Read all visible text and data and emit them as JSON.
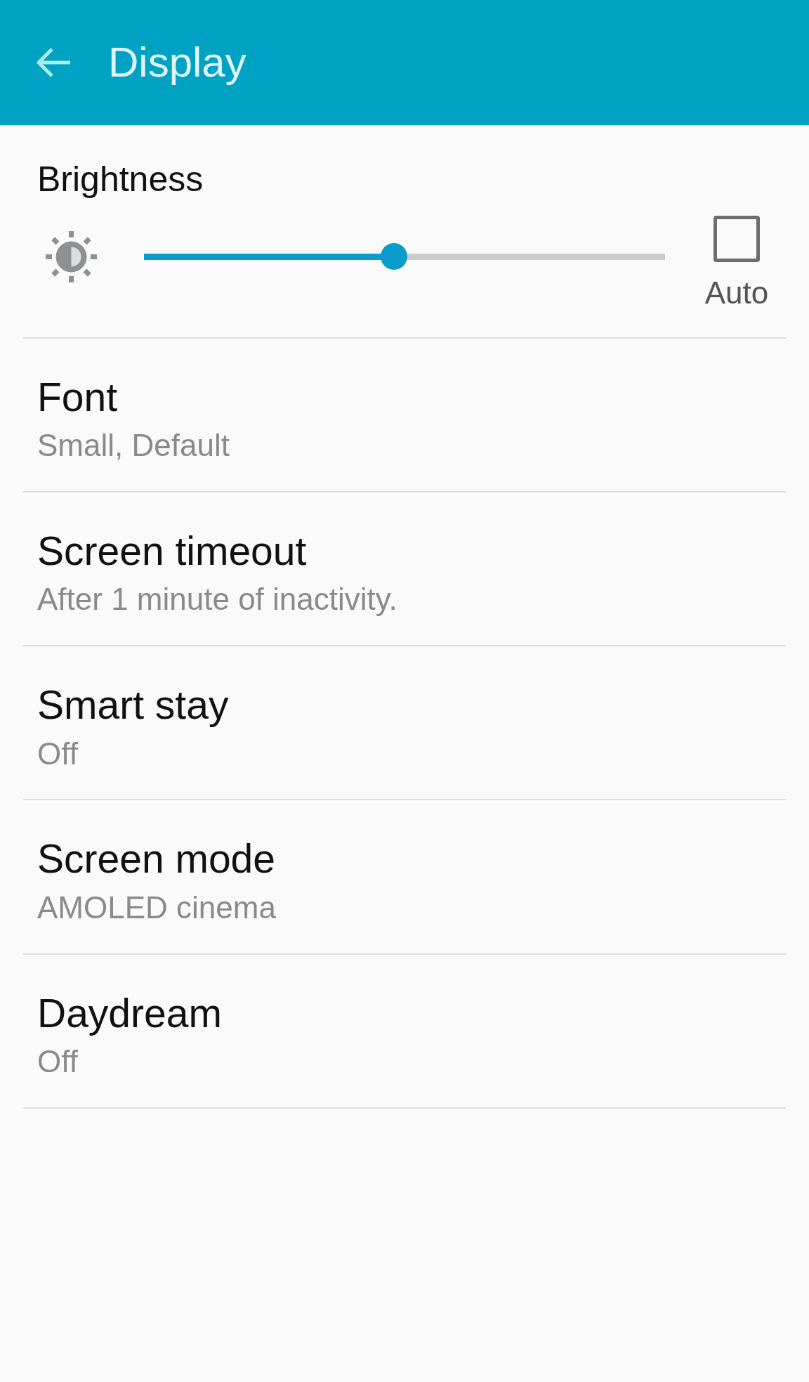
{
  "app_bar": {
    "title": "Display"
  },
  "brightness": {
    "label": "Brightness",
    "level": 0.48,
    "auto": {
      "label": "Auto",
      "checked": false
    }
  },
  "settings": [
    {
      "title": "Font",
      "summary": "Small, Default"
    },
    {
      "title": "Screen timeout",
      "summary": "After 1 minute of inactivity."
    },
    {
      "title": "Smart stay",
      "summary": "Off"
    },
    {
      "title": "Screen mode",
      "summary": "AMOLED cinema"
    },
    {
      "title": "Daydream",
      "summary": "Off"
    }
  ]
}
